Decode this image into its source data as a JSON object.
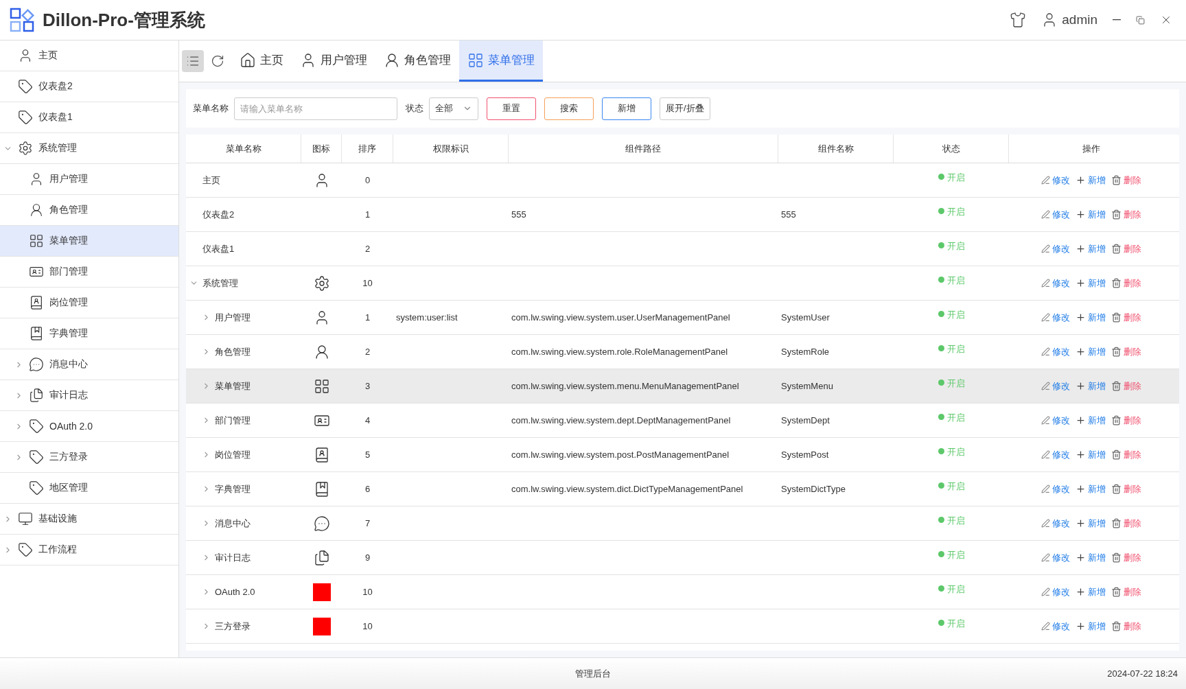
{
  "header": {
    "title": "Dillon-Pro-管理系统",
    "user": "admin"
  },
  "sidebar": {
    "items": [
      {
        "label": "主页",
        "kind": "user",
        "selected": false
      },
      {
        "label": "仪表盘2",
        "kind": "tag",
        "selected": false
      },
      {
        "label": "仪表盘1",
        "kind": "tag",
        "selected": false
      },
      {
        "label": "系统管理",
        "kind": "gear",
        "selected": false,
        "expanded": true,
        "children": [
          {
            "label": "用户管理",
            "kind": "user",
            "selected": false
          },
          {
            "label": "角色管理",
            "kind": "user-round",
            "selected": false
          },
          {
            "label": "菜单管理",
            "kind": "grid",
            "selected": true
          },
          {
            "label": "部门管理",
            "kind": "id-card",
            "selected": false
          },
          {
            "label": "岗位管理",
            "kind": "contact-book",
            "selected": false
          },
          {
            "label": "字典管理",
            "kind": "book",
            "selected": false
          },
          {
            "label": "消息中心",
            "kind": "chat",
            "selected": false,
            "expanded": false
          },
          {
            "label": "审计日志",
            "kind": "document",
            "selected": false,
            "expanded": false
          },
          {
            "label": "OAuth 2.0",
            "kind": "tag",
            "selected": false,
            "expanded": false
          },
          {
            "label": "三方登录",
            "kind": "tag",
            "selected": false,
            "expanded": false
          },
          {
            "label": "地区管理",
            "kind": "tag",
            "selected": false
          }
        ]
      },
      {
        "label": "基础设施",
        "kind": "monitor",
        "selected": false,
        "expanded": false
      },
      {
        "label": "工作流程",
        "kind": "tag",
        "selected": false,
        "expanded": false
      }
    ]
  },
  "tabs": [
    {
      "label": "主页",
      "kind": "home",
      "selected": false
    },
    {
      "label": "用户管理",
      "kind": "user",
      "selected": false
    },
    {
      "label": "角色管理",
      "kind": "user-round",
      "selected": false
    },
    {
      "label": "菜单管理",
      "kind": "grid",
      "selected": true
    }
  ],
  "filter": {
    "name_label": "菜单名称",
    "name_placeholder": "请输入菜单名称",
    "status_label": "状态",
    "status_value": "全部",
    "buttons": [
      {
        "label": "重置",
        "kind": "reset"
      },
      {
        "label": "搜索",
        "kind": "search"
      },
      {
        "label": "新增",
        "kind": "add"
      },
      {
        "label": "展开/折叠",
        "kind": "plain"
      }
    ]
  },
  "table": {
    "columns": [
      "菜单名称",
      "图标",
      "排序",
      "权限标识",
      "组件路径",
      "组件名称",
      "状态",
      "操作"
    ],
    "rows": [
      {
        "name": "主页",
        "kind": "user",
        "order": "0",
        "hovered": false,
        "status": {
          "label": "开启",
          "on": true
        },
        "actions": [
          {
            "label": "修改",
            "kind": "edit"
          },
          {
            "label": "新增",
            "kind": "add"
          },
          {
            "label": "删除",
            "kind": "delete"
          }
        ]
      },
      {
        "name": "仪表盘2",
        "order": "1",
        "hovered": false,
        "path": "555",
        "component": "555",
        "status": {
          "label": "开启",
          "on": true
        },
        "actions": [
          {
            "label": "修改",
            "kind": "edit"
          },
          {
            "label": "新增",
            "kind": "add"
          },
          {
            "label": "删除",
            "kind": "delete"
          }
        ]
      },
      {
        "name": "仪表盘1",
        "order": "2",
        "hovered": false,
        "status": {
          "label": "开启",
          "on": true
        },
        "actions": [
          {
            "label": "修改",
            "kind": "edit"
          },
          {
            "label": "新增",
            "kind": "add"
          },
          {
            "label": "删除",
            "kind": "delete"
          }
        ]
      },
      {
        "name": "系统管理",
        "kind": "gear",
        "order": "10",
        "hovered": false,
        "expanded": true,
        "status": {
          "label": "开启",
          "on": true
        },
        "actions": [
          {
            "label": "修改",
            "kind": "edit"
          },
          {
            "label": "新增",
            "kind": "add"
          },
          {
            "label": "删除",
            "kind": "delete"
          }
        ],
        "children": [
          {
            "name": "用户管理",
            "kind": "user",
            "order": "1",
            "permission": "system:user:list",
            "path": "com.lw.swing.view.system.user.UserManagementPanel",
            "component": "SystemUser",
            "hovered": false,
            "expanded": false,
            "status": {
              "label": "开启",
              "on": true
            },
            "actions": [
              {
                "label": "修改",
                "kind": "edit"
              },
              {
                "label": "新增",
                "kind": "add"
              },
              {
                "label": "删除",
                "kind": "delete"
              }
            ]
          },
          {
            "name": "角色管理",
            "kind": "user-round",
            "order": "2",
            "path": "com.lw.swing.view.system.role.RoleManagementPanel",
            "component": "SystemRole",
            "hovered": false,
            "expanded": false,
            "status": {
              "label": "开启",
              "on": true
            },
            "actions": [
              {
                "label": "修改",
                "kind": "edit"
              },
              {
                "label": "新增",
                "kind": "add"
              },
              {
                "label": "删除",
                "kind": "delete"
              }
            ]
          },
          {
            "name": "菜单管理",
            "kind": "grid",
            "order": "3",
            "path": "com.lw.swing.view.system.menu.MenuManagementPanel",
            "component": "SystemMenu",
            "hovered": true,
            "expanded": false,
            "status": {
              "label": "开启",
              "on": true
            },
            "actions": [
              {
                "label": "修改",
                "kind": "edit"
              },
              {
                "label": "新增",
                "kind": "add"
              },
              {
                "label": "删除",
                "kind": "delete"
              }
            ]
          },
          {
            "name": "部门管理",
            "kind": "id-card",
            "order": "4",
            "path": "com.lw.swing.view.system.dept.DeptManagementPanel",
            "component": "SystemDept",
            "hovered": false,
            "expanded": false,
            "status": {
              "label": "开启",
              "on": true
            },
            "actions": [
              {
                "label": "修改",
                "kind": "edit"
              },
              {
                "label": "新增",
                "kind": "add"
              },
              {
                "label": "删除",
                "kind": "delete"
              }
            ]
          },
          {
            "name": "岗位管理",
            "kind": "contact-book",
            "order": "5",
            "path": "com.lw.swing.view.system.post.PostManagementPanel",
            "component": "SystemPost",
            "hovered": false,
            "expanded": false,
            "status": {
              "label": "开启",
              "on": true
            },
            "actions": [
              {
                "label": "修改",
                "kind": "edit"
              },
              {
                "label": "新增",
                "kind": "add"
              },
              {
                "label": "删除",
                "kind": "delete"
              }
            ]
          },
          {
            "name": "字典管理",
            "kind": "book",
            "order": "6",
            "path": "com.lw.swing.view.system.dict.DictTypeManagementPanel",
            "component": "SystemDictType",
            "hovered": false,
            "expanded": false,
            "status": {
              "label": "开启",
              "on": true
            },
            "actions": [
              {
                "label": "修改",
                "kind": "edit"
              },
              {
                "label": "新增",
                "kind": "add"
              },
              {
                "label": "删除",
                "kind": "delete"
              }
            ]
          },
          {
            "name": "消息中心",
            "kind": "chat",
            "order": "7",
            "hovered": false,
            "expanded": false,
            "status": {
              "label": "开启",
              "on": true
            },
            "actions": [
              {
                "label": "修改",
                "kind": "edit"
              },
              {
                "label": "新增",
                "kind": "add"
              },
              {
                "label": "删除",
                "kind": "delete"
              }
            ]
          },
          {
            "name": "审计日志",
            "kind": "document",
            "order": "9",
            "hovered": false,
            "expanded": false,
            "status": {
              "label": "开启",
              "on": true
            },
            "actions": [
              {
                "label": "修改",
                "kind": "edit"
              },
              {
                "label": "新增",
                "kind": "add"
              },
              {
                "label": "删除",
                "kind": "delete"
              }
            ]
          },
          {
            "name": "OAuth 2.0",
            "kind": "square",
            "order": "10",
            "hovered": false,
            "expanded": false,
            "status": {
              "label": "开启",
              "on": true
            },
            "actions": [
              {
                "label": "修改",
                "kind": "edit"
              },
              {
                "label": "新增",
                "kind": "add"
              },
              {
                "label": "删除",
                "kind": "delete"
              }
            ]
          },
          {
            "name": "三方登录",
            "kind": "square",
            "order": "10",
            "hovered": false,
            "expanded": false,
            "status": {
              "label": "开启",
              "on": true
            },
            "actions": [
              {
                "label": "修改",
                "kind": "edit"
              },
              {
                "label": "新增",
                "kind": "add"
              },
              {
                "label": "删除",
                "kind": "delete"
              }
            ]
          }
        ]
      }
    ]
  },
  "footer": {
    "center": "管理后台",
    "time": "2024-07-22 18:24"
  }
}
